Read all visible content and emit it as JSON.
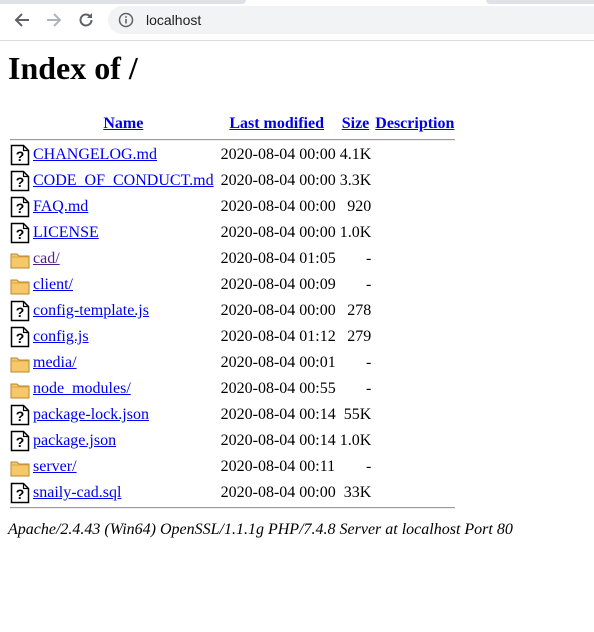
{
  "browser": {
    "url": "localhost",
    "icons": {
      "back": "arrow-left-icon",
      "forward": "arrow-right-icon",
      "reload": "reload-icon",
      "info": "info-circle-icon"
    }
  },
  "page": {
    "title": "Index of /",
    "columns": {
      "name": "Name",
      "last_modified": "Last modified",
      "size": "Size",
      "description": "Description"
    },
    "files": [
      {
        "name": "CHANGELOG.md",
        "modified": "2020-08-04 00:00",
        "size": "4.1K",
        "type": "file"
      },
      {
        "name": "CODE_OF_CONDUCT.md",
        "modified": "2020-08-04 00:00",
        "size": "3.3K",
        "type": "file"
      },
      {
        "name": "FAQ.md",
        "modified": "2020-08-04 00:00",
        "size": "920",
        "type": "file"
      },
      {
        "name": "LICENSE",
        "modified": "2020-08-04 00:00",
        "size": "1.0K",
        "type": "file"
      },
      {
        "name": "cad/",
        "modified": "2020-08-04 01:05",
        "size": "-",
        "type": "folder",
        "visited": true
      },
      {
        "name": "client/",
        "modified": "2020-08-04 00:09",
        "size": "-",
        "type": "folder"
      },
      {
        "name": "config-template.js",
        "modified": "2020-08-04 00:00",
        "size": "278",
        "type": "file"
      },
      {
        "name": "config.js",
        "modified": "2020-08-04 01:12",
        "size": "279",
        "type": "file"
      },
      {
        "name": "media/",
        "modified": "2020-08-04 00:01",
        "size": "-",
        "type": "folder"
      },
      {
        "name": "node_modules/",
        "modified": "2020-08-04 00:55",
        "size": "-",
        "type": "folder"
      },
      {
        "name": "package-lock.json",
        "modified": "2020-08-04 00:14",
        "size": "55K",
        "type": "file"
      },
      {
        "name": "package.json",
        "modified": "2020-08-04 00:14",
        "size": "1.0K",
        "type": "file"
      },
      {
        "name": "server/",
        "modified": "2020-08-04 00:11",
        "size": "-",
        "type": "folder"
      },
      {
        "name": "snaily-cad.sql",
        "modified": "2020-08-04 00:00",
        "size": "33K",
        "type": "file"
      }
    ],
    "address": "Apache/2.4.43 (Win64) OpenSSL/1.1.1g PHP/7.4.8 Server at localhost Port 80"
  },
  "colors": {
    "link": "#0000ee",
    "visited": "#551a8b",
    "folder": "#f7c86a"
  }
}
